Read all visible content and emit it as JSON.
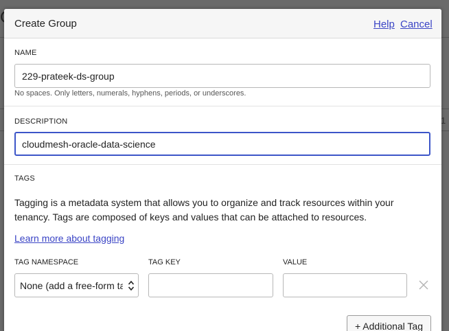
{
  "modal": {
    "title": "Create Group",
    "help_label": "Help",
    "cancel_label": "Cancel"
  },
  "name_field": {
    "label": "NAME",
    "value": "229-prateek-ds-group",
    "hint": "No spaces. Only letters, numerals, hyphens, periods, or underscores."
  },
  "description_field": {
    "label": "DESCRIPTION",
    "value": "cloudmesh-oracle-data-science"
  },
  "tags": {
    "label": "TAGS",
    "description": "Tagging is a metadata system that allows you to organize and track resources within your tenancy. Tags are composed of keys and values that can be attached to resources.",
    "learn_more": "Learn more about tagging",
    "namespace_label": "TAG NAMESPACE",
    "key_label": "TAG KEY",
    "value_label": "VALUE",
    "namespace_selected": "None (add a free-form tag)",
    "key_value": "",
    "value_value": "",
    "add_button": "+ Additional Tag"
  },
  "colors": {
    "link": "#3a44c5",
    "focus_border": "#3c55c8"
  }
}
